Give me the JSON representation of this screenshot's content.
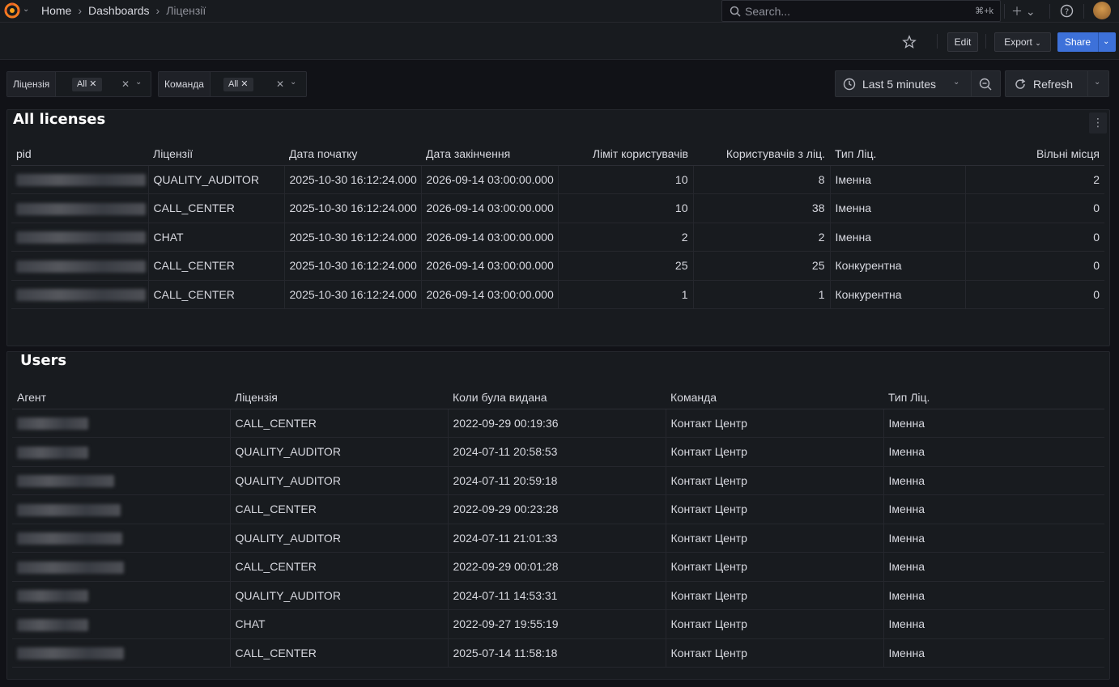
{
  "breadcrumb": {
    "home": "Home",
    "dashboards": "Dashboards",
    "current": "Ліцензії"
  },
  "search": {
    "placeholder": "Search...",
    "shortcut": "⌘+k"
  },
  "toolbar": {
    "edit": "Edit",
    "export": "Export",
    "share": "Share"
  },
  "variables": [
    {
      "label": "Ліцензія",
      "value": "All"
    },
    {
      "label": "Команда",
      "value": "All"
    }
  ],
  "time_range": {
    "label": "Last 5 minutes"
  },
  "refresh": {
    "label": "Refresh"
  },
  "colors": {
    "background": "#111217",
    "panel": "#181b1f",
    "accent": "#3d71d9",
    "text": "#d8d9e0"
  },
  "licenses_panel": {
    "title": "All licenses",
    "columns": [
      "pid",
      "Ліцензії",
      "Дата початку",
      "Дата закінчення",
      "Ліміт користувачів",
      "Користувачів з ліц.",
      "Тип Ліц.",
      "Вільні місця"
    ],
    "rows": [
      {
        "license": "QUALITY_AUDITOR",
        "start": "2025-10-30 16:12:24.000",
        "end": "2026-09-14 03:00:00.000",
        "limit": "10",
        "users": "8",
        "type": "Іменна",
        "free": "2"
      },
      {
        "license": "CALL_CENTER",
        "start": "2025-10-30 16:12:24.000",
        "end": "2026-09-14 03:00:00.000",
        "limit": "10",
        "users": "38",
        "type": "Іменна",
        "free": "0"
      },
      {
        "license": "CHAT",
        "start": "2025-10-30 16:12:24.000",
        "end": "2026-09-14 03:00:00.000",
        "limit": "2",
        "users": "2",
        "type": "Іменна",
        "free": "0"
      },
      {
        "license": "CALL_CENTER",
        "start": "2025-10-30 16:12:24.000",
        "end": "2026-09-14 03:00:00.000",
        "limit": "25",
        "users": "25",
        "type": "Конкурентна",
        "free": "0"
      },
      {
        "license": "CALL_CENTER",
        "start": "2025-10-30 16:12:24.000",
        "end": "2026-09-14 03:00:00.000",
        "limit": "1",
        "users": "1",
        "type": "Конкурентна",
        "free": "0"
      }
    ]
  },
  "users_panel": {
    "title": "Users",
    "columns": [
      "Агент",
      "Ліцензія",
      "Коли була видана",
      "Команда",
      "Тип Ліц."
    ],
    "rows": [
      {
        "license": "CALL_CENTER",
        "issued": "2022-09-29 00:19:36",
        "team": "Контакт Центр",
        "type": "Іменна"
      },
      {
        "license": "QUALITY_AUDITOR",
        "issued": "2024-07-11 20:58:53",
        "team": "Контакт Центр",
        "type": "Іменна"
      },
      {
        "license": "QUALITY_AUDITOR",
        "issued": "2024-07-11 20:59:18",
        "team": "Контакт Центр",
        "type": "Іменна"
      },
      {
        "license": "CALL_CENTER",
        "issued": "2022-09-29 00:23:28",
        "team": "Контакт Центр",
        "type": "Іменна"
      },
      {
        "license": "QUALITY_AUDITOR",
        "issued": "2024-07-11 21:01:33",
        "team": "Контакт Центр",
        "type": "Іменна"
      },
      {
        "license": "CALL_CENTER",
        "issued": "2022-09-29 00:01:28",
        "team": "Контакт Центр",
        "type": "Іменна"
      },
      {
        "license": "QUALITY_AUDITOR",
        "issued": "2024-07-11 14:53:31",
        "team": "Контакт Центр",
        "type": "Іменна"
      },
      {
        "license": "CHAT",
        "issued": "2022-09-27 19:55:19",
        "team": "Контакт Центр",
        "type": "Іменна"
      },
      {
        "license": "CALL_CENTER",
        "issued": "2025-07-14 11:58:18",
        "team": "Контакт Центр",
        "type": "Іменна"
      }
    ]
  }
}
